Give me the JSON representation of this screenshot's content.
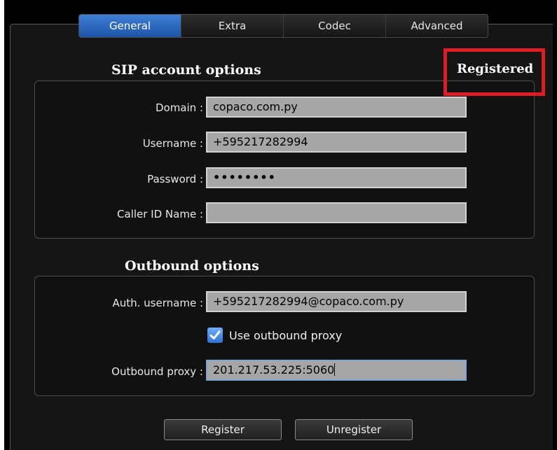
{
  "tabs": [
    "General",
    "Extra",
    "Codec",
    "Advanced"
  ],
  "sip": {
    "title": "SIP account options",
    "status": "Registered",
    "domain": {
      "label": "Domain :",
      "value": "copaco.com.py"
    },
    "username": {
      "label": "Username :",
      "value": "+595217282994"
    },
    "password": {
      "label": "Password :",
      "value": "••••••••"
    },
    "caller_id": {
      "label": "Caller ID Name :",
      "value": ""
    }
  },
  "outbound": {
    "title": "Outbound options",
    "auth_username": {
      "label": "Auth. username :",
      "value": "+595217282994@copaco.com.py"
    },
    "use_proxy": {
      "label": "Use outbound proxy",
      "checked": true
    },
    "proxy": {
      "label": "Outbound proxy :",
      "value": "201.217.53.225:5060"
    }
  },
  "buttons": {
    "register": "Register",
    "unregister": "Unregister"
  },
  "colors": {
    "accent": "#2f6fd1",
    "status_box": "#e01d24",
    "field_bg": "#a6a6a6"
  }
}
